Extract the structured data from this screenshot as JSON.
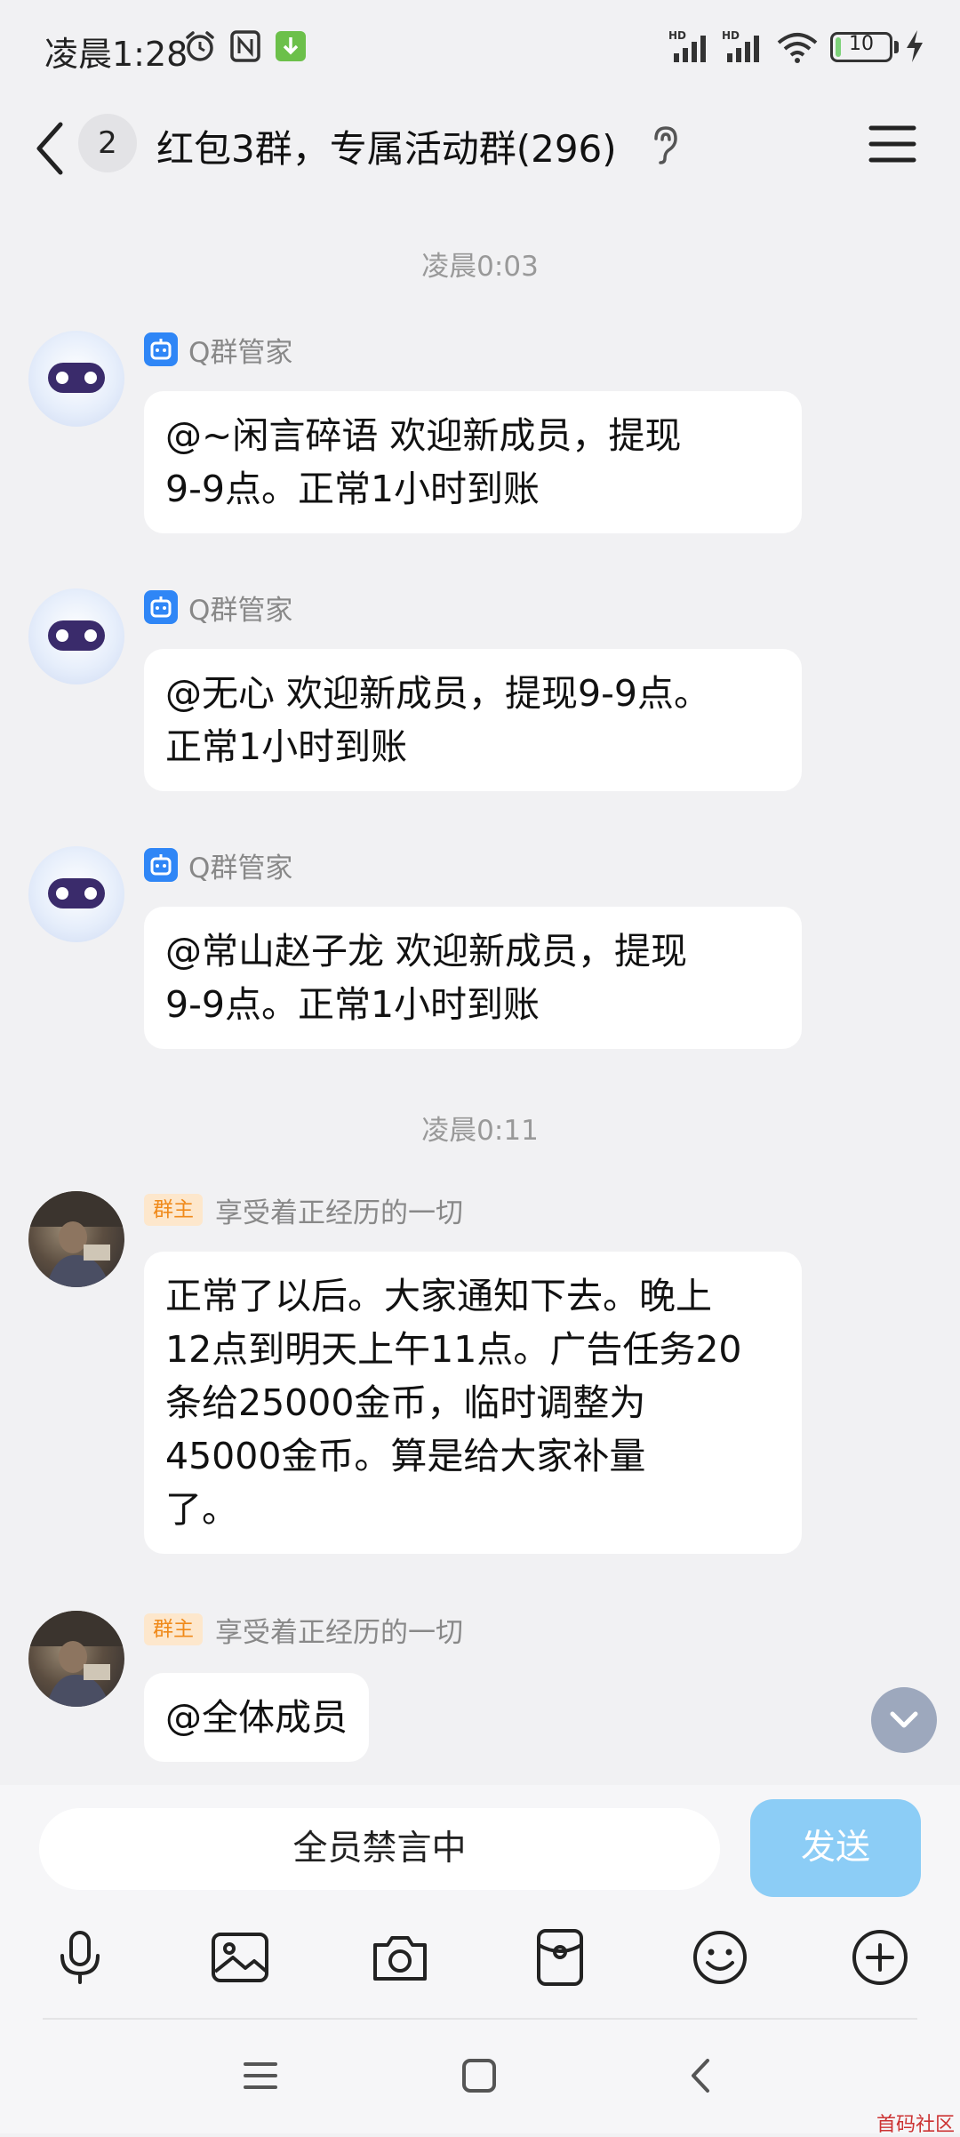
{
  "status_bar": {
    "time": "凌晨1:28",
    "battery_level": "10",
    "battery_fraction": 0.1,
    "icons": [
      "alarm-icon",
      "nfc-icon",
      "download-icon",
      "hd-signal-icon",
      "hd-signal-icon",
      "wifi-icon",
      "battery-icon",
      "charging-icon"
    ]
  },
  "header": {
    "back_icon": "chevron-left-icon",
    "unread_count": "2",
    "title": "红包3群，专属活动群(296)",
    "ear_icon": "ear-icon",
    "menu_icon": "menu-icon"
  },
  "chat": {
    "timestamps": [
      "凌晨0:03",
      "凌晨0:11"
    ],
    "messages": [
      {
        "sender": "Q群管家",
        "role": "bot",
        "text": "@~闲言碎语 欢迎新成员，提现\n9-9点。正常1小时到账"
      },
      {
        "sender": "Q群管家",
        "role": "bot",
        "text": "@无心 欢迎新成员，提现9-9点。\n正常1小时到账"
      },
      {
        "sender": "Q群管家",
        "role": "bot",
        "text": "@常山赵子龙 欢迎新成员，提现\n9-9点。正常1小时到账"
      },
      {
        "sender": "享受着正经历的一切",
        "role": "owner",
        "badge": "群主",
        "text": "正常了以后。大家通知下去。晚上\n12点到明天上午11点。广告任务20\n条给25000金币，临时调整为\n45000金币。算是给大家补量\n了。"
      },
      {
        "sender": "享受着正经历的一切",
        "role": "owner",
        "badge": "群主",
        "text": "@全体成员"
      }
    ]
  },
  "input": {
    "muted_text": "全员禁言中",
    "send_label": "发送",
    "tools": [
      "microphone-icon",
      "image-icon",
      "camera-icon",
      "red-packet-icon",
      "emoji-icon",
      "plus-icon"
    ]
  },
  "nav": [
    "menu-nav-icon",
    "home-nav-icon",
    "back-nav-icon"
  ],
  "watermark": "首码社区",
  "colors": {
    "background": "#f1f1f3",
    "send_button": "#8ccdf6",
    "bot_badge": "#2f86f6",
    "owner_badge_text": "#f08a1a"
  }
}
